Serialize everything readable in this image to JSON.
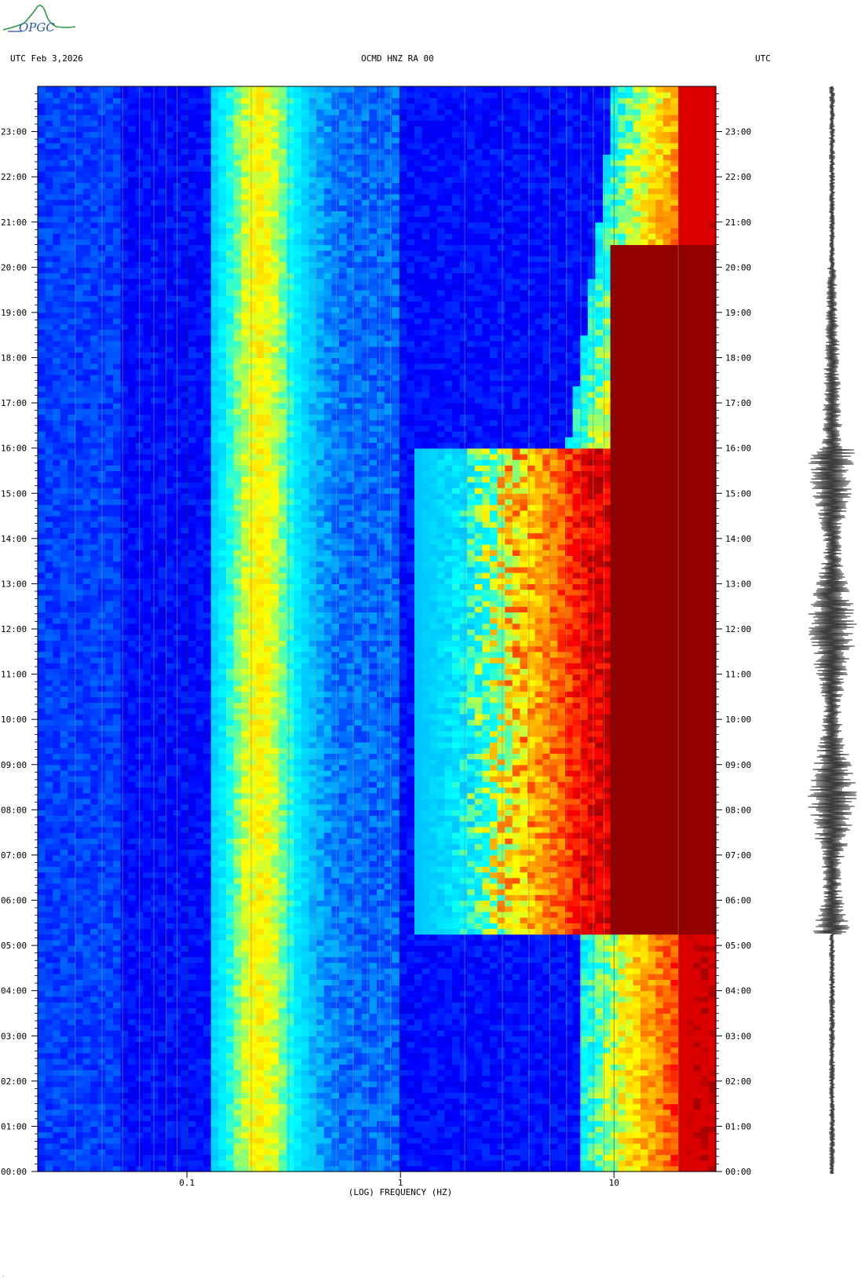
{
  "logo": {
    "text": "OPGC"
  },
  "header": {
    "left": "UTC  Feb 3,2026",
    "center": "OCMD HNZ RA 00",
    "right": "UTC"
  },
  "chart_data": {
    "type": "heatmap",
    "title": "OCMD HNZ RA 00",
    "xlabel": "(LOG) FREQUENCY (HZ)",
    "x_scale": "log",
    "xlim": [
      0.02,
      30
    ],
    "x_ticks": [
      {
        "value": 0.1,
        "label": "0.1"
      },
      {
        "value": 1,
        "label": "1"
      },
      {
        "value": 10,
        "label": "10"
      }
    ],
    "ylabel": "UTC",
    "ylim_hours": [
      0,
      24
    ],
    "y_ticks": [
      "00:00",
      "01:00",
      "02:00",
      "03:00",
      "04:00",
      "05:00",
      "06:00",
      "07:00",
      "08:00",
      "09:00",
      "10:00",
      "11:00",
      "12:00",
      "13:00",
      "14:00",
      "15:00",
      "16:00",
      "17:00",
      "18:00",
      "19:00",
      "20:00",
      "21:00",
      "22:00",
      "23:00"
    ],
    "colormap": [
      "#00008b",
      "#0000ff",
      "#00bfff",
      "#00ffff",
      "#ffff00",
      "#ff8c00",
      "#ff0000",
      "#8b0000"
    ],
    "activity_window_hours": [
      5.3,
      16.0
    ],
    "high_frequency_saturation_hz": 10,
    "seismogram": {
      "position": "right",
      "color": "#000000"
    }
  }
}
